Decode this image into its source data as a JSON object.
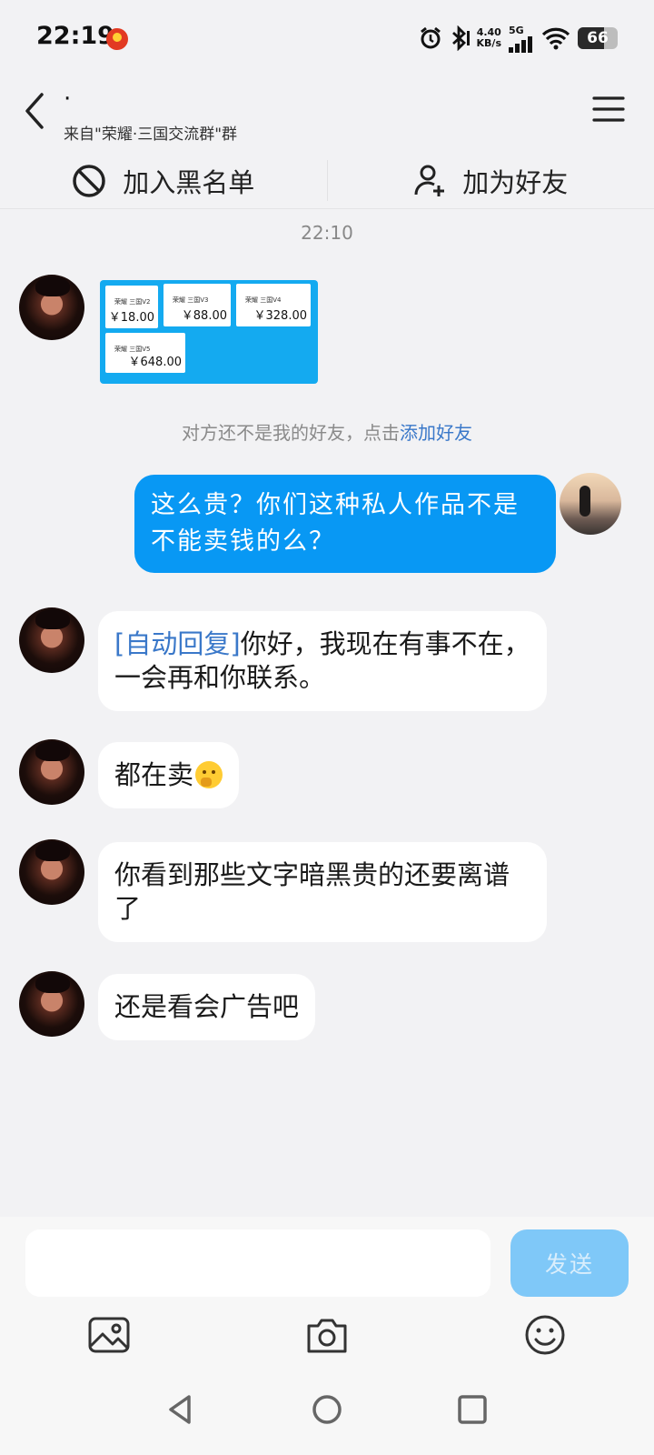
{
  "status_bar": {
    "time": "22:19",
    "net_speed_value": "4.40",
    "net_speed_unit": "KB/s",
    "network_gen": "5G",
    "battery": "66",
    "battery_level_percent": 66
  },
  "header": {
    "title": "·",
    "subtitle": "来自\"荣耀·三国交流群\"群"
  },
  "actions": {
    "block_label": "加入黑名单",
    "add_friend_label": "加为好友"
  },
  "chat": {
    "timestamp": "22:10",
    "price_items": [
      {
        "name": "荣耀 三国V2",
        "price": "￥18.00"
      },
      {
        "name": "荣耀 三国V3",
        "price": "￥88.00"
      },
      {
        "name": "荣耀 三国V4",
        "price": "￥328.00"
      },
      {
        "name": "荣耀 三国V5",
        "price": "￥648.00"
      }
    ],
    "system_hint": "对方还不是我的好友，点击",
    "system_hint_link": "添加好友",
    "messages": [
      {
        "from": "me",
        "text": "这么贵？你们这种私人作品不是不能卖钱的么？"
      },
      {
        "from": "them",
        "tag": "[自动回复]",
        "text": "你好，我现在有事不在，一会再和你联系。"
      },
      {
        "from": "them",
        "text": "都在卖"
      },
      {
        "from": "them",
        "text": "你看到那些文字暗黑贵的还要离谱了"
      },
      {
        "from": "them",
        "text": "还是看会广告吧"
      }
    ]
  },
  "input": {
    "value": "",
    "send_label": "发送"
  },
  "icons": {
    "back": "chevron-left-icon",
    "menu": "hamburger-icon",
    "block": "prohibit-icon",
    "add_friend": "user-plus-icon",
    "image": "image-icon",
    "camera": "camera-icon",
    "emoji": "smile-icon"
  },
  "colors": {
    "accent_blue": "#0898f4",
    "link_blue": "#3a78c9",
    "send_disabled": "#7fc8f8"
  }
}
